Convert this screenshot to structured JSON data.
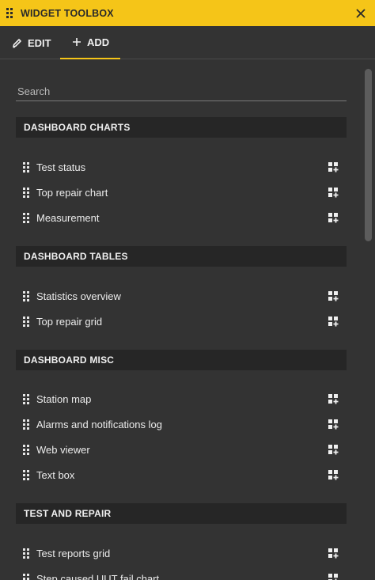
{
  "window": {
    "title": "WIDGET TOOLBOX",
    "accent_color": "#f5c518"
  },
  "tabs": [
    {
      "label": "EDIT",
      "icon": "pencil-icon",
      "active": false
    },
    {
      "label": "ADD",
      "icon": "plus-icon",
      "active": true
    }
  ],
  "search": {
    "placeholder": "Search",
    "value": ""
  },
  "sections": [
    {
      "title": "DASHBOARD CHARTS",
      "items": [
        "Test status",
        "Top repair chart",
        "Measurement"
      ]
    },
    {
      "title": "DASHBOARD TABLES",
      "items": [
        "Statistics overview",
        "Top repair grid"
      ]
    },
    {
      "title": "DASHBOARD MISC",
      "items": [
        "Station map",
        "Alarms and notifications log",
        "Web viewer",
        "Text box"
      ]
    },
    {
      "title": "TEST AND REPAIR",
      "items": [
        "Test reports grid",
        "Step caused UUT fail chart"
      ]
    }
  ]
}
